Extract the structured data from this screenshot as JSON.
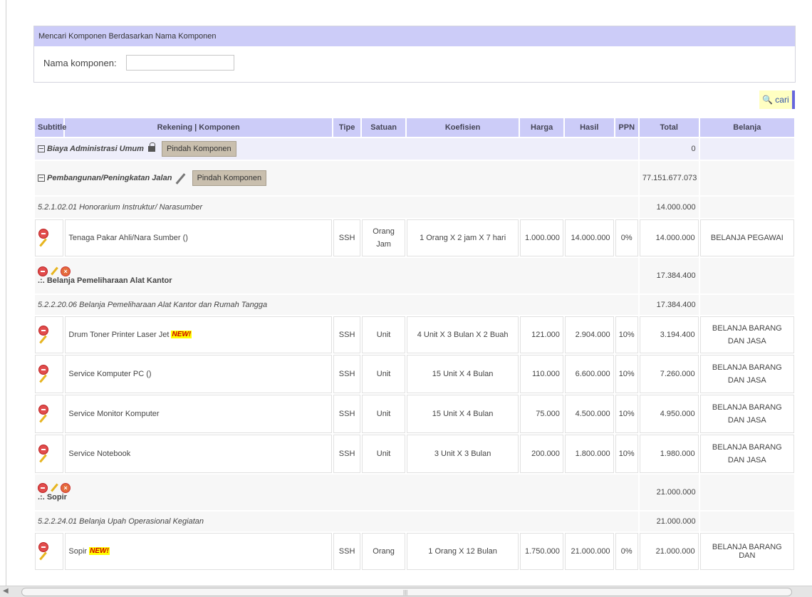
{
  "search": {
    "title": "Mencari Komponen Berdasarkan Nama Komponen",
    "label": "Nama komponen:",
    "value": ""
  },
  "cari_label": "cari",
  "headers": [
    "Subtitle",
    "Rekening | Komponen",
    "Tipe",
    "Satuan",
    "Koefisien",
    "Harga",
    "Hasil",
    "PPN",
    "Total",
    "Belanja"
  ],
  "rows": {
    "sub1": {
      "name": "Biaya Administrasi Umum",
      "move": "Pindah Komponen",
      "total": "0"
    },
    "sub2": {
      "name": "Pembangunan/Peningkatan Jalan",
      "move": "Pindah Komponen",
      "total": "77.151.677.073"
    },
    "rek1": {
      "text": "5.2.1.02.01 Honorarium Instruktur/ Narasumber",
      "total": "14.000.000"
    },
    "item1": {
      "name": "Tenaga Pakar Ahli/Nara Sumber ()",
      "tipe": "SSH",
      "satuan": "Orang Jam",
      "koef": "1 Orang X 2 jam X 7 hari",
      "harga": "1.000.000",
      "hasil": "14.000.000",
      "ppn": "0%",
      "total": "14.000.000",
      "belanja": "BELANJA PEGAWAI"
    },
    "grp1": {
      "name": ".:. Belanja Pemeliharaan Alat Kantor",
      "total": "17.384.400"
    },
    "rek2": {
      "text": "5.2.2.20.06 Belanja Pemeliharaan Alat Kantor dan Rumah Tangga",
      "total": "17.384.400"
    },
    "item2": {
      "name": "Drum Toner Printer Laser Jet",
      "badge": "NEW!",
      "tipe": "SSH",
      "satuan": "Unit",
      "koef": "4 Unit X 3 Bulan X 2 Buah",
      "harga": "121.000",
      "hasil": "2.904.000",
      "ppn": "10%",
      "total": "3.194.400",
      "belanja": "BELANJA BARANG DAN JASA"
    },
    "item3": {
      "name": "Service Komputer PC ()",
      "tipe": "SSH",
      "satuan": "Unit",
      "koef": "15 Unit X 4 Bulan",
      "harga": "110.000",
      "hasil": "6.600.000",
      "ppn": "10%",
      "total": "7.260.000",
      "belanja": "BELANJA BARANG DAN JASA"
    },
    "item4": {
      "name": "Service Monitor Komputer",
      "tipe": "SSH",
      "satuan": "Unit",
      "koef": "15 Unit X 4 Bulan",
      "harga": "75.000",
      "hasil": "4.500.000",
      "ppn": "10%",
      "total": "4.950.000",
      "belanja": "BELANJA BARANG DAN JASA"
    },
    "item5": {
      "name": "Service Notebook",
      "tipe": "SSH",
      "satuan": "Unit",
      "koef": "3 Unit X 3 Bulan",
      "harga": "200.000",
      "hasil": "1.800.000",
      "ppn": "10%",
      "total": "1.980.000",
      "belanja": "BELANJA BARANG DAN JASA"
    },
    "grp2": {
      "name": ".:. Sopir",
      "total": "21.000.000"
    },
    "rek3": {
      "text": "5.2.2.24.01 Belanja Upah Operasional Kegiatan",
      "total": "21.000.000"
    },
    "item6": {
      "name": "Sopir",
      "badge": "NEW!",
      "tipe": "SSH",
      "satuan": "Orang",
      "koef": "1 Orang X 12 Bulan",
      "harga": "1.750.000",
      "hasil": "21.000.000",
      "ppn": "0%",
      "total": "21.000.000",
      "belanja": "BELANJA BARANG DAN"
    }
  },
  "colors": {
    "header_bg": "#ccccf8",
    "button_bg": "#c9bfae",
    "new_badge": "#ffff00"
  }
}
